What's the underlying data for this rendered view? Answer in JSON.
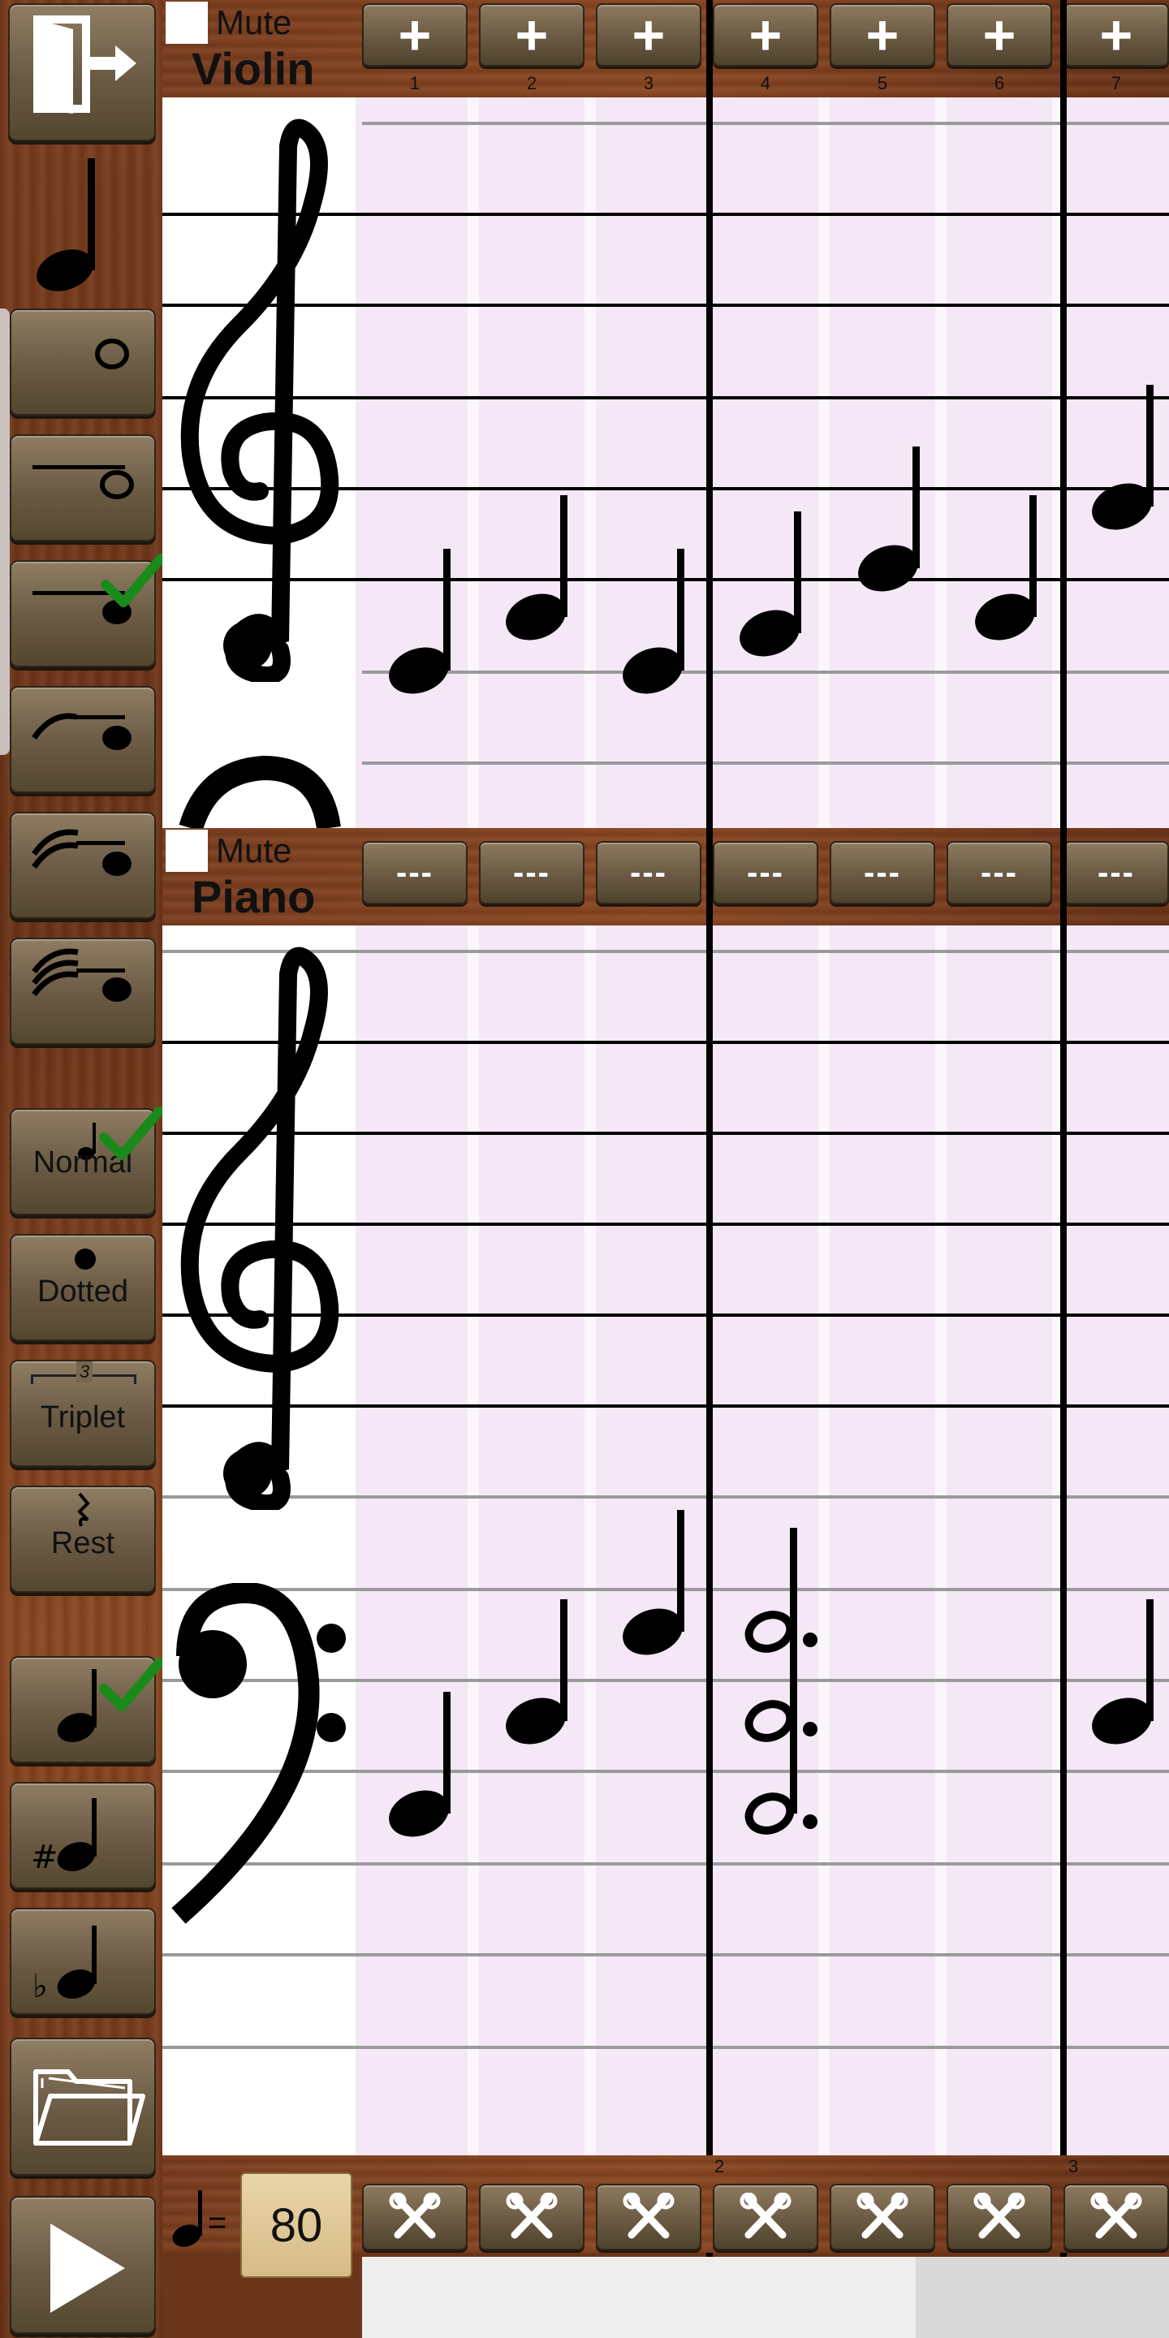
{
  "sidebar": {
    "exit_icon": "exit-door-icon",
    "current_note_icon": "quarter-note-icon",
    "durations": [
      "whole-note-icon",
      "half-note-icon",
      "quarter-note-icon",
      "eighth-note-icon",
      "sixteenth-note-icon",
      "thirty-second-note-icon"
    ],
    "selected_duration": "quarter-note-icon",
    "modifiers": [
      {
        "label": "Normal",
        "selected": true
      },
      {
        "label": "Dotted",
        "selected": false
      },
      {
        "label": "Triplet",
        "selected": false
      },
      {
        "label": "Rest",
        "selected": false
      }
    ],
    "triplet_mark": "3",
    "accidentals": [
      "natural",
      "sharp",
      "flat"
    ],
    "selected_accidental": "natural",
    "open_icon": "folder-icon",
    "play_icon": "play-icon"
  },
  "tracks": [
    {
      "mute_label": "Mute",
      "name": "Violin",
      "header_buttons": [
        "+",
        "+",
        "+",
        "+",
        "+",
        "+",
        "+"
      ]
    },
    {
      "mute_label": "Mute",
      "name": "Piano",
      "header_buttons": [
        "---",
        "---",
        "---",
        "---",
        "---",
        "---",
        "---"
      ]
    }
  ],
  "column_numbers": [
    "1",
    "2",
    "3",
    "4",
    "5",
    "6",
    "7"
  ],
  "measure_numbers": [
    "2",
    "3"
  ],
  "tempo": {
    "value": "80",
    "equals": "="
  },
  "colors": {
    "accent_check": "#1a8a1a",
    "staff_bg": "#f4e7f6",
    "wood": "#6b3519"
  }
}
